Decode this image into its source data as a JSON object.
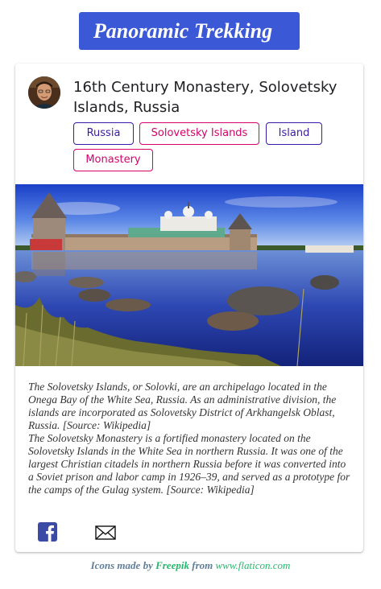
{
  "brand": {
    "title": "Panoramic Trekking"
  },
  "post": {
    "title": "16th Century Monastery, Solovetsky Islands, Russia",
    "avatar_icon": "person-avatar",
    "tags": [
      {
        "label": "Russia",
        "color": "#3a1aa8"
      },
      {
        "label": "Solovetsky Islands",
        "color": "#d6006a"
      },
      {
        "label": "Island",
        "color": "#3a1aa8"
      },
      {
        "label": "Monastery",
        "color": "#d6006a"
      }
    ],
    "description": [
      "The Solovetsky Islands, or Solovki, are an archipelago located in the Onega Bay of the White Sea, Russia. As an administrative division, the islands are incorporated as Solovetsky District of Arkhangelsk Oblast, Russia. [Source: Wikipedia]",
      "The Solovetsky Monastery is a fortified monastery located on the Solovetsky Islands in the White Sea in northern Russia. It was one of the largest Christian citadels in northern Russia before it was converted into a Soviet prison and labor camp in 1926–39, and served as a prototype for the camps of the Gulag system. [Source: Wikipedia]"
    ],
    "share": {
      "facebook_icon": "facebook-icon",
      "email_icon": "envelope-icon"
    }
  },
  "credits": {
    "prefix": "Icons made by",
    "author": "Freepik",
    "middle": "from",
    "site": "www.flaticon.com"
  },
  "colors": {
    "brand_bg": "#3b58d6",
    "tag_purple": "#3a1aa8",
    "tag_pink": "#d6006a",
    "credit_link": "#24b86d"
  }
}
